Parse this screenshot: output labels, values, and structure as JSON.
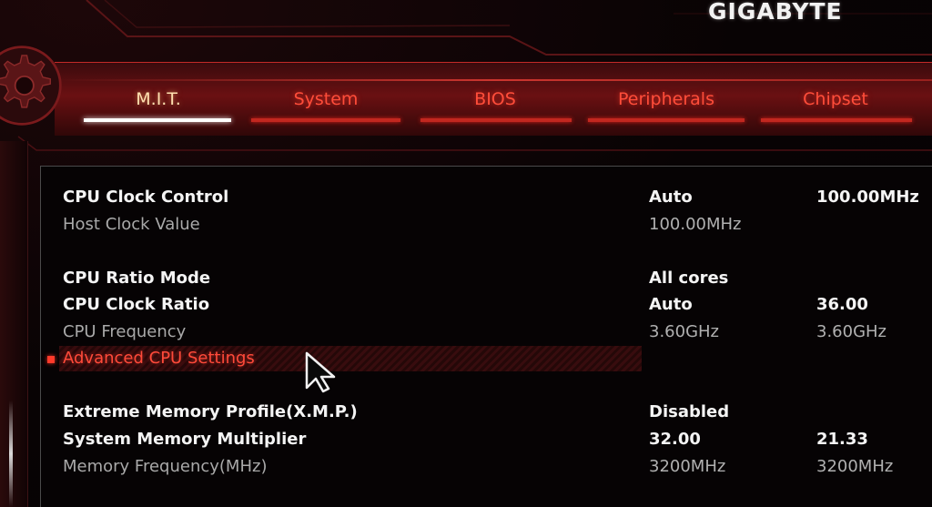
{
  "brand": {
    "logo_text": "GIGABYTE"
  },
  "tabs": [
    {
      "label": "M.I.T.",
      "active": true
    },
    {
      "label": "System",
      "active": false
    },
    {
      "label": "BIOS",
      "active": false
    },
    {
      "label": "Peripherals",
      "active": false
    },
    {
      "label": "Chipset",
      "active": false
    }
  ],
  "settings": {
    "cpu_clock_control": {
      "label": "CPU Clock Control",
      "value1": "Auto",
      "value2": "100.00MHz"
    },
    "host_clock_value": {
      "label": "Host Clock Value",
      "value1": "100.00MHz",
      "value2": ""
    },
    "cpu_ratio_mode": {
      "label": "CPU Ratio Mode",
      "value1": "All cores",
      "value2": ""
    },
    "cpu_clock_ratio": {
      "label": "CPU Clock Ratio",
      "value1": "Auto",
      "value2": "36.00"
    },
    "cpu_frequency": {
      "label": "CPU Frequency",
      "value1": "3.60GHz",
      "value2": "3.60GHz"
    },
    "advanced_cpu_settings": {
      "label": "Advanced CPU Settings",
      "selected": true
    },
    "xmp": {
      "label": "Extreme Memory Profile(X.M.P.)",
      "value1": "Disabled",
      "value2": ""
    },
    "system_memory_multiplier": {
      "label": "System Memory Multiplier",
      "value1": "32.00",
      "value2": "21.33"
    },
    "memory_frequency": {
      "label": "Memory Frequency(MHz)",
      "value1": "3200MHz",
      "value2": "3200MHz"
    }
  },
  "icons": {
    "settings": "gear-icon",
    "selection": "bullet-icon",
    "pointer": "mouse-cursor-icon"
  },
  "colors": {
    "accent": "#ff4a3a",
    "active_tab": "#ffe0b0",
    "background": "#070304",
    "text_primary": "#f4f4f4",
    "text_dim": "#a9a9a9"
  }
}
